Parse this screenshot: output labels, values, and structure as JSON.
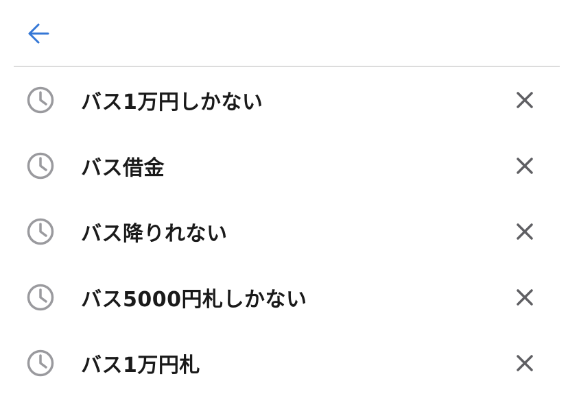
{
  "header": {
    "back_icon": "arrow-left-icon",
    "accent_color": "#3477d6"
  },
  "history": {
    "icon": "clock-icon",
    "remove_icon": "close-icon",
    "icon_color": "#9a9a9e",
    "remove_color": "#5f5f63",
    "items": [
      {
        "label": "バス1万円しかない"
      },
      {
        "label": "バス借金"
      },
      {
        "label": "バス降りれない"
      },
      {
        "label": "バス5000円札しかない"
      },
      {
        "label": "バス1万円札"
      }
    ]
  }
}
